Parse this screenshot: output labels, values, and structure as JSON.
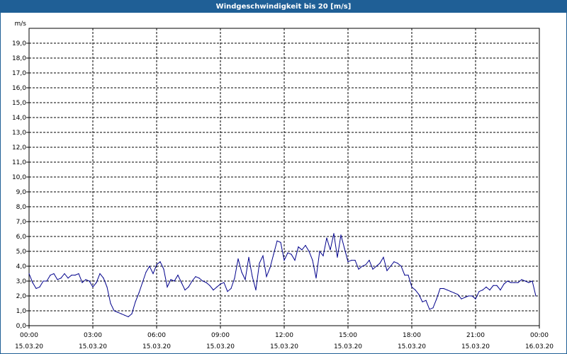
{
  "window": {
    "title": "Windgeschwindigkeit bis 20 [m/s]"
  },
  "colors": {
    "titlebar": "#1f5f96",
    "line": "#00008b",
    "grid": "#000000"
  },
  "chart_data": {
    "type": "line",
    "title": "Windgeschwindigkeit bis 20 [m/s]",
    "ylabel": "m/s",
    "xlabel": "",
    "ylim": [
      0,
      20
    ],
    "xlim": [
      "15.03.20 00:00",
      "16.03.20 00:00"
    ],
    "grid": true,
    "y_ticks": [
      "0,0",
      "1,0",
      "2,0",
      "3,0",
      "4,0",
      "5,0",
      "6,0",
      "7,0",
      "8,0",
      "9,0",
      "10,0",
      "11,0",
      "12,0",
      "13,0",
      "14,0",
      "15,0",
      "16,0",
      "17,0",
      "18,0",
      "19,0"
    ],
    "x_ticks": [
      {
        "time": "00:00",
        "date": "15.03.20"
      },
      {
        "time": "03:00",
        "date": "15.03.20"
      },
      {
        "time": "06:00",
        "date": "15.03.20"
      },
      {
        "time": "09:00",
        "date": "15.03.20"
      },
      {
        "time": "12:00",
        "date": "15.03.20"
      },
      {
        "time": "15:00",
        "date": "15.03.20"
      },
      {
        "time": "18:00",
        "date": "15.03.20"
      },
      {
        "time": "21:00",
        "date": "15.03.20"
      },
      {
        "time": "00:00",
        "date": "16.03.20"
      }
    ],
    "series": [
      {
        "x": [
          "00:00",
          "00:10",
          "00:20",
          "00:30",
          "00:40",
          "00:50",
          "01:00",
          "01:10",
          "01:20",
          "01:30",
          "01:40",
          "01:50",
          "02:00",
          "02:10",
          "02:20",
          "02:30",
          "02:40",
          "02:50",
          "03:00",
          "03:10",
          "03:20",
          "03:30",
          "03:40",
          "03:50",
          "04:00",
          "04:10",
          "04:20",
          "04:30",
          "04:40",
          "04:50",
          "05:00",
          "05:10",
          "05:20",
          "05:30",
          "05:40",
          "05:50",
          "06:00",
          "06:10",
          "06:20",
          "06:30",
          "06:40",
          "06:50",
          "07:00",
          "07:10",
          "07:20",
          "07:30",
          "07:40",
          "07:50",
          "08:00",
          "08:10",
          "08:20",
          "08:30",
          "08:40",
          "08:50",
          "09:00",
          "09:10",
          "09:20",
          "09:30",
          "09:40",
          "09:50",
          "10:00",
          "10:10",
          "10:20",
          "10:30",
          "10:40",
          "10:50",
          "11:00",
          "11:10",
          "11:20",
          "11:30",
          "11:40",
          "11:50",
          "12:00",
          "12:10",
          "12:20",
          "12:30",
          "12:40",
          "12:50",
          "13:00",
          "13:10",
          "13:20",
          "13:30",
          "13:40",
          "13:50",
          "14:00",
          "14:10",
          "14:20",
          "14:30",
          "14:40",
          "14:50",
          "15:00",
          "15:10",
          "15:20",
          "15:30",
          "15:40",
          "15:50",
          "16:00",
          "16:10",
          "16:20",
          "16:30",
          "16:40",
          "16:50",
          "17:00",
          "17:10",
          "17:20",
          "17:30",
          "17:40",
          "17:50",
          "18:00",
          "18:10",
          "18:20",
          "18:30",
          "18:40",
          "18:50",
          "19:00",
          "19:10",
          "19:20",
          "19:30",
          "19:40",
          "19:50",
          "20:00",
          "20:10",
          "20:20",
          "20:30",
          "20:40",
          "20:50",
          "21:00",
          "21:10",
          "21:20",
          "21:30",
          "21:40",
          "21:50",
          "22:00",
          "22:10",
          "22:20",
          "22:30",
          "22:40",
          "22:50",
          "23:00",
          "23:10",
          "23:20",
          "23:30",
          "23:40",
          "23:50"
        ],
        "values": [
          3.5,
          2.9,
          2.5,
          2.6,
          3.0,
          3.0,
          3.4,
          3.5,
          3.1,
          3.2,
          3.5,
          3.2,
          3.4,
          3.4,
          3.5,
          2.9,
          3.1,
          3.0,
          2.6,
          2.9,
          3.5,
          3.2,
          2.6,
          1.5,
          1.0,
          0.9,
          0.8,
          0.7,
          0.6,
          0.8,
          1.6,
          2.2,
          2.9,
          3.6,
          4.0,
          3.5,
          4.1,
          4.3,
          3.8,
          2.6,
          3.1,
          3.0,
          3.4,
          2.9,
          2.4,
          2.6,
          3.0,
          3.3,
          3.2,
          3.0,
          2.9,
          2.7,
          2.4,
          2.6,
          2.8,
          2.9,
          2.3,
          2.5,
          3.2,
          4.5,
          3.6,
          3.1,
          4.6,
          3.3,
          2.4,
          4.2,
          4.7,
          3.3,
          3.9,
          4.8,
          5.7,
          5.6,
          4.4,
          4.9,
          4.8,
          4.4,
          5.3,
          5.1,
          5.4,
          5.0,
          4.4,
          3.2,
          5.0,
          4.7,
          5.9,
          5.1,
          6.2,
          4.6,
          6.1,
          5.2,
          4.3,
          4.4,
          4.4,
          3.8,
          4.0,
          4.1,
          4.4,
          3.8,
          4.0,
          4.2,
          4.6,
          3.7,
          4.0,
          4.3,
          4.2,
          4.0,
          3.4,
          3.4,
          2.6,
          2.4,
          2.1,
          1.6,
          1.7,
          1.1,
          1.2,
          1.8,
          2.5,
          2.5,
          2.4,
          2.3,
          2.2,
          2.1,
          1.8,
          1.9,
          2.0,
          2.0,
          1.8,
          2.3,
          2.4,
          2.6,
          2.4,
          2.7,
          2.7,
          2.4,
          2.8,
          3.0,
          2.9,
          2.9,
          2.9,
          3.1,
          3.0,
          2.9,
          3.0,
          2.0
        ]
      }
    ]
  }
}
